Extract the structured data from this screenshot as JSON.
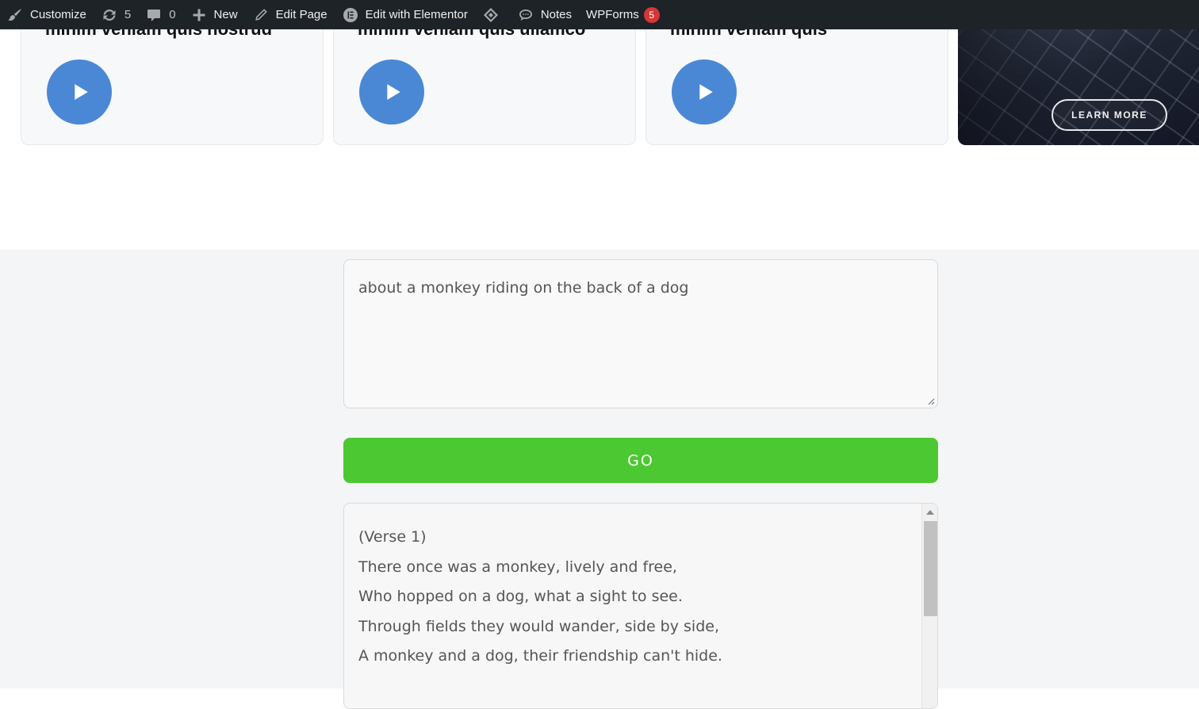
{
  "adminbar": {
    "customize": "Customize",
    "updates_count": "5",
    "comments_count": "0",
    "new": "New",
    "edit_page": "Edit Page",
    "edit_elementor": "Edit with Elementor",
    "notes": "Notes",
    "wpforms": "WPForms",
    "wpforms_badge": "5"
  },
  "cards": [
    {
      "title": "minim veniam quis nostrud"
    },
    {
      "title": "minim veniam quis ullamco"
    },
    {
      "title": "minim veniam quis"
    }
  ],
  "promo": {
    "button_label": "LEARN MORE"
  },
  "generator": {
    "prompt_value": "about a monkey riding on the back of a dog",
    "go_label": "GO",
    "output_lines": [
      "(Verse 1)",
      "There once was a monkey, lively and free,",
      "Who hopped on a dog, what a sight to see.",
      "Through fields they would wander, side by side,",
      "A monkey and a dog, their friendship can't hide."
    ]
  },
  "colors": {
    "adminbar_bg": "#1d2327",
    "play_button": "#4a88d6",
    "go_button": "#4cc832",
    "badge": "#d63638"
  },
  "icons": {
    "customize": "brush-icon",
    "updates": "refresh-icon",
    "comments": "comment-icon",
    "new": "plus-icon",
    "edit_page": "pencil-icon",
    "elementor": "elementor-icon",
    "diamond": "diamond-icon",
    "notes": "speech-bubble-icon",
    "play": "play-icon"
  }
}
